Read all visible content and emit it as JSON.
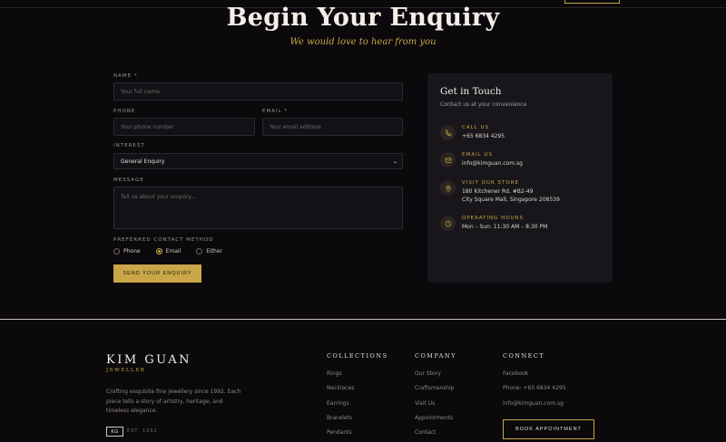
{
  "hero": {
    "title": "Begin Your Enquiry",
    "subtitle": "We would love to hear from you"
  },
  "form": {
    "name_label": "NAME *",
    "name_placeholder": "Your full name",
    "phone_label": "PHONE",
    "phone_placeholder": "Your phone number",
    "email_label": "EMAIL *",
    "email_placeholder": "Your email address",
    "interest_label": "INTEREST",
    "interest_value": "General Enquiry",
    "message_label": "MESSAGE",
    "message_placeholder": "Tell us about your enquiry...",
    "contact_method_label": "PREFERRED CONTACT METHOD",
    "contact_methods": [
      "Phone",
      "Email",
      "Either"
    ],
    "contact_method_selected": "Email",
    "submit_label": "SEND YOUR ENQUIRY"
  },
  "contact_card": {
    "title": "Get in Touch",
    "subtitle": "Contact us at your convenience",
    "call": {
      "title": "CALL US",
      "value": "+65 6834 4295"
    },
    "email": {
      "title": "EMAIL US",
      "value": "info@kimguan.com.sg"
    },
    "visit": {
      "title": "VISIT OUR STORE",
      "line1": "180 Kitchener Rd, #B2-49",
      "line2": "City Square Mall, Singapore 208539"
    },
    "hours": {
      "title": "OPERATING HOURS",
      "value": "Mon – Sun: 11:30 AM – 8:30 PM"
    }
  },
  "footer": {
    "brand": "KIM GUAN",
    "brand_sub": "JEWELLER",
    "description": "Crafting exquisite fine jewellery since 1992. Each piece tells a story of artistry, heritage, and timeless elegance.",
    "badge": "KG",
    "established": "EST. 1992",
    "collections": {
      "heading": "COLLECTIONS",
      "items": [
        "Rings",
        "Necklaces",
        "Earrings",
        "Bracelets",
        "Pendants"
      ]
    },
    "company": {
      "heading": "COMPANY",
      "items": [
        "Our Story",
        "Craftsmanship",
        "Visit Us",
        "Appointments",
        "Contact"
      ]
    },
    "connect": {
      "heading": "CONNECT",
      "items": [
        "Facebook",
        "Phone: +65 6834 4295",
        "info@kimguan.com.sg"
      ],
      "book_label": "BOOK APPOINTMENT"
    }
  },
  "colors": {
    "background": "#0b090c",
    "accent_gold": "#c9a648",
    "card": "#18161a"
  },
  "icons": {
    "call": "phone-icon",
    "email": "mail-icon",
    "visit": "map-pin-icon",
    "hours": "clock-icon"
  }
}
